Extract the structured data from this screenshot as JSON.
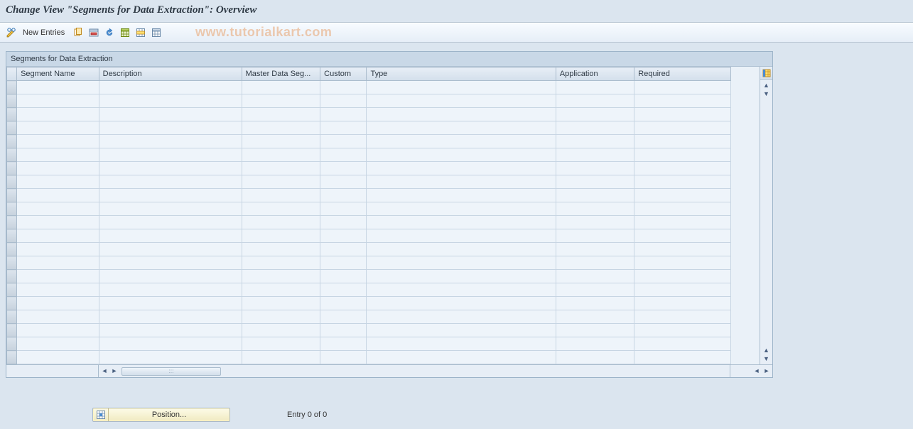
{
  "header": {
    "title": "Change View \"Segments for Data Extraction\": Overview"
  },
  "toolbar": {
    "new_entries_label": "New Entries"
  },
  "watermark": "www.tutorialkart.com",
  "grid": {
    "title": "Segments for Data Extraction",
    "columns": {
      "segment_name": "Segment Name",
      "description": "Description",
      "master_data_seg": "Master Data Seg...",
      "custom": "Custom",
      "type": "Type",
      "application": "Application",
      "required": "Required"
    },
    "rows": [
      {},
      {},
      {},
      {},
      {},
      {},
      {},
      {},
      {},
      {},
      {},
      {},
      {},
      {},
      {},
      {},
      {},
      {},
      {},
      {},
      {}
    ]
  },
  "footer": {
    "position_label": "Position...",
    "entry_status": "Entry 0 of 0"
  }
}
